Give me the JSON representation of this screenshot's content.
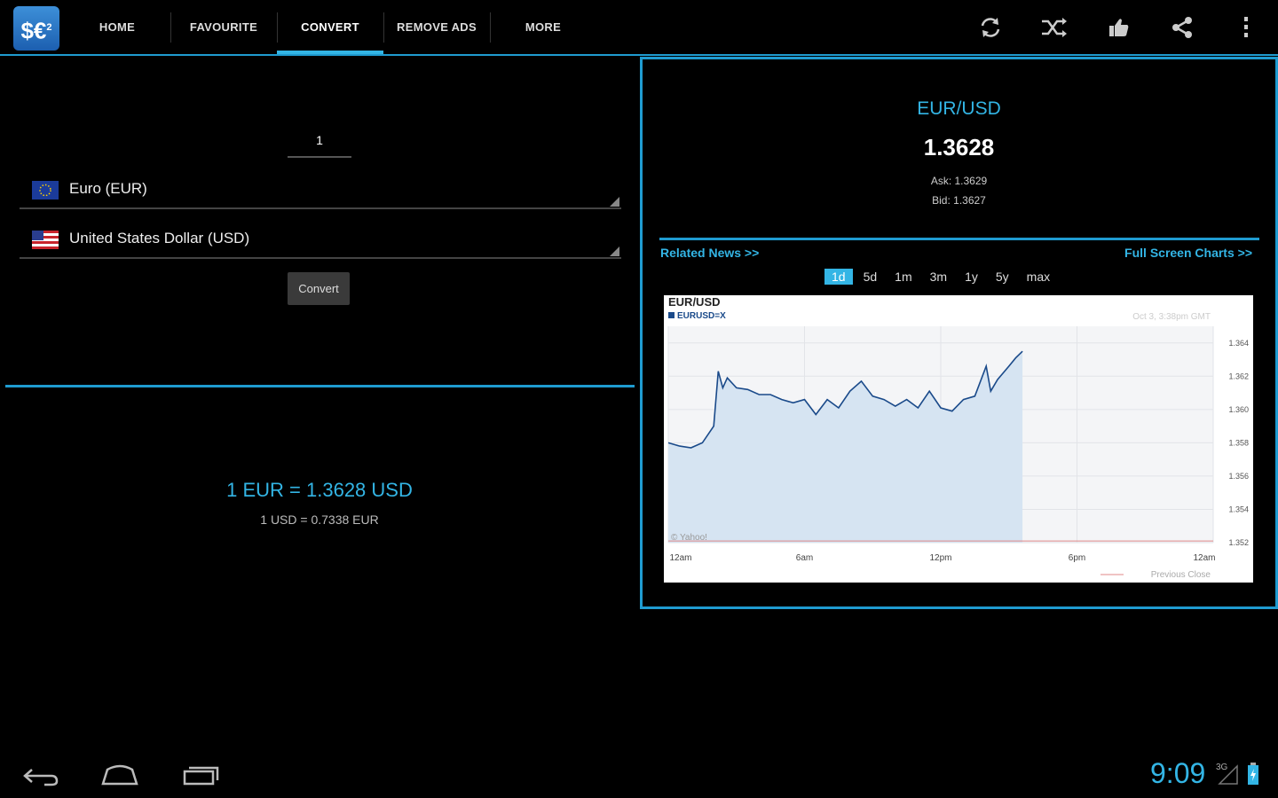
{
  "app": {
    "icon_text": "$€",
    "icon_sup": "2"
  },
  "tabs": [
    {
      "label": "HOME"
    },
    {
      "label": "FAVOURITE"
    },
    {
      "label": "CONVERT"
    },
    {
      "label": "REMOVE ADS"
    },
    {
      "label": "MORE"
    }
  ],
  "active_tab": "CONVERT",
  "actions": [
    "refresh-icon",
    "shuffle-icon",
    "thumbs-up-icon",
    "share-icon",
    "overflow-menu-icon"
  ],
  "converter": {
    "amount": "1",
    "from_currency": "Euro (EUR)",
    "to_currency": "United States Dollar (USD)",
    "convert_label": "Convert",
    "result_main": "1 EUR = 1.3628 USD",
    "result_sub": "1 USD = 0.7338 EUR"
  },
  "quote": {
    "pair": "EUR/USD",
    "rate": "1.3628",
    "ask": "Ask: 1.3629",
    "bid": "Bid: 1.3627",
    "related_news": "Related News >>",
    "full_screen_charts": "Full Screen Charts >>",
    "ranges": [
      "1d",
      "5d",
      "1m",
      "3m",
      "1y",
      "5y",
      "max"
    ],
    "active_range": "1d"
  },
  "colors": {
    "accent": "#33b5e5",
    "border": "#1f9bd0",
    "chart_fill": "#d6e4f2",
    "chart_line": "#1a4a8a",
    "prev_close": "#e08a8a"
  },
  "chart_data": {
    "type": "line",
    "title": "EUR/USD",
    "legend": "EURUSD=X",
    "timestamp": "Oct 3, 3:38pm GMT",
    "watermark": "© Yahoo!",
    "previous_close_label": "Previous Close",
    "x_ticks": [
      "12am",
      "6am",
      "12pm",
      "6pm",
      "12am"
    ],
    "y_ticks": [
      "1.364",
      "1.362",
      "1.360",
      "1.358",
      "1.356",
      "1.354",
      "1.352"
    ],
    "ylim": [
      1.352,
      1.365
    ],
    "xlim_hours": [
      0,
      24
    ],
    "previous_close": 1.3521,
    "series": [
      {
        "x": [
          0,
          0.5,
          1,
          1.5,
          2,
          2.2,
          2.4,
          2.6,
          3,
          3.5,
          4,
          4.5,
          5,
          5.5,
          6,
          6.5,
          7,
          7.5,
          8,
          8.5,
          9,
          9.5,
          10,
          10.5,
          11,
          11.5,
          12,
          12.5,
          13,
          13.5,
          14,
          14.2,
          14.5,
          15,
          15.3,
          15.6
        ],
        "y": [
          1.358,
          1.3578,
          1.3577,
          1.358,
          1.359,
          1.3623,
          1.3613,
          1.3619,
          1.3613,
          1.3612,
          1.3609,
          1.3609,
          1.3606,
          1.3604,
          1.3606,
          1.3597,
          1.3606,
          1.3601,
          1.3611,
          1.3617,
          1.3608,
          1.3606,
          1.3602,
          1.3606,
          1.3601,
          1.3611,
          1.3601,
          1.3599,
          1.3606,
          1.3608,
          1.3626,
          1.3611,
          1.3618,
          1.3626,
          1.3631,
          1.3635
        ]
      }
    ]
  }
}
